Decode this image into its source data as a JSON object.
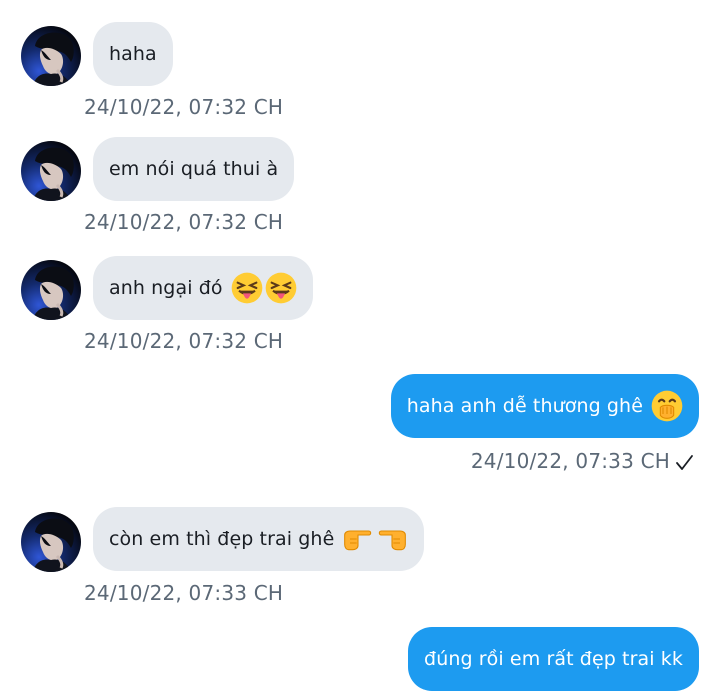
{
  "messages": [
    {
      "side": "in",
      "text": "haha",
      "timestamp": "24/10/22,  07:32 CH"
    },
    {
      "side": "in",
      "text": "em nói quá thui à",
      "timestamp": "24/10/22,  07:32 CH"
    },
    {
      "side": "in",
      "text": "anh ngại đó",
      "emojis": [
        "squinting-tongue-emoji",
        "squinting-tongue-emoji"
      ],
      "timestamp": "24/10/22,  07:32 CH"
    },
    {
      "side": "out",
      "text": "haha anh dễ thương ghê",
      "emojis": [
        "hand-over-mouth-emoji"
      ],
      "timestamp": "24/10/22,  07:33 CH",
      "status_icon": "checkmark-icon"
    },
    {
      "side": "in",
      "text": "còn em thì đẹp trai ghê",
      "emojis": [
        "pointing-right-emoji",
        "pointing-left-emoji"
      ],
      "timestamp": "24/10/22,  07:33 CH"
    },
    {
      "side": "out",
      "text": "đúng rồi em rất đẹp trai kk"
    }
  ],
  "colors": {
    "incoming_bubble": "#e5e9ee",
    "outgoing_bubble": "#1d9bf0",
    "timestamp": "#5b6876"
  }
}
